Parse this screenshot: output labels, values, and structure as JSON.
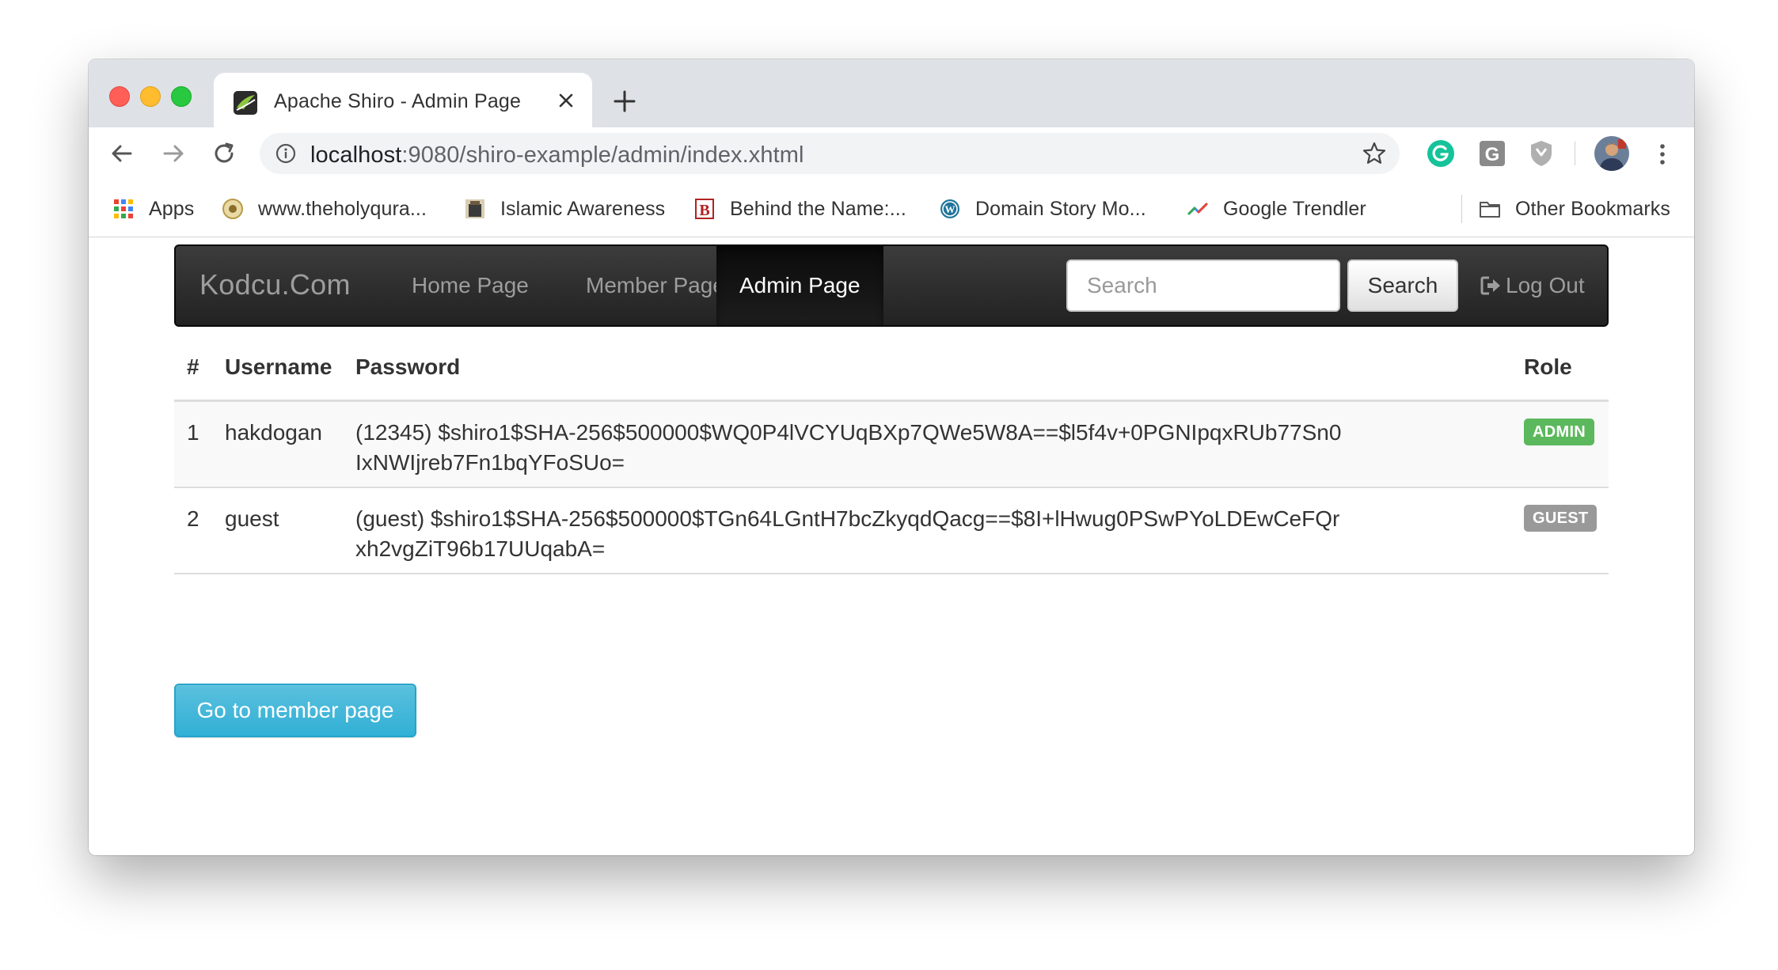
{
  "browser": {
    "tab_title": "Apache Shiro - Admin Page",
    "url_host": "localhost",
    "url_rest": ":9080/shiro-example/admin/index.xhtml"
  },
  "bookmarks": [
    {
      "label": "Apps",
      "icon": "apps-grid-icon"
    },
    {
      "label": "www.theholyqura...",
      "icon": "quran-site-icon"
    },
    {
      "label": "Islamic Awareness",
      "icon": "islamic-awareness-icon"
    },
    {
      "label": "Behind the Name:...",
      "icon": "behind-the-name-icon"
    },
    {
      "label": "Domain Story Mo...",
      "icon": "wordpress-icon"
    },
    {
      "label": "Google Trendler",
      "icon": "google-trends-icon"
    },
    {
      "label": "Other Bookmarks",
      "icon": "folder-icon"
    }
  ],
  "navbar": {
    "brand": "Kodcu.Com",
    "links": [
      "Home Page",
      "Member Page",
      "Admin Page"
    ],
    "active_link": "Admin Page",
    "search_placeholder": "Search",
    "search_button": "Search",
    "logout": "Log Out"
  },
  "table": {
    "headers": [
      "#",
      "Username",
      "Password",
      "Role"
    ],
    "rows": [
      {
        "num": "1",
        "username": "hakdogan",
        "password": "(12345) $shiro1$SHA-256$500000$WQ0P4lVCYUqBXp7QWe5W8A==$l5f4v+0PGNIpqxRUb77Sn0IxNWIjreb7Fn1bqYFoSUo=",
        "role": "ADMIN"
      },
      {
        "num": "2",
        "username": "guest",
        "password": "(guest) $shiro1$SHA-256$500000$TGn64LGntH7bcZkyqdQacg==$8I+lHwug0PSwPYoLDEwCeFQrxh2vgZiT96b17UUqabA=",
        "role": "GUEST"
      }
    ]
  },
  "go_button": "Go to member page",
  "colors": {
    "navbar": "#222222",
    "admin_badge": "#5cb85c",
    "guest_badge": "#999999",
    "info_button": "#5bc0de"
  }
}
